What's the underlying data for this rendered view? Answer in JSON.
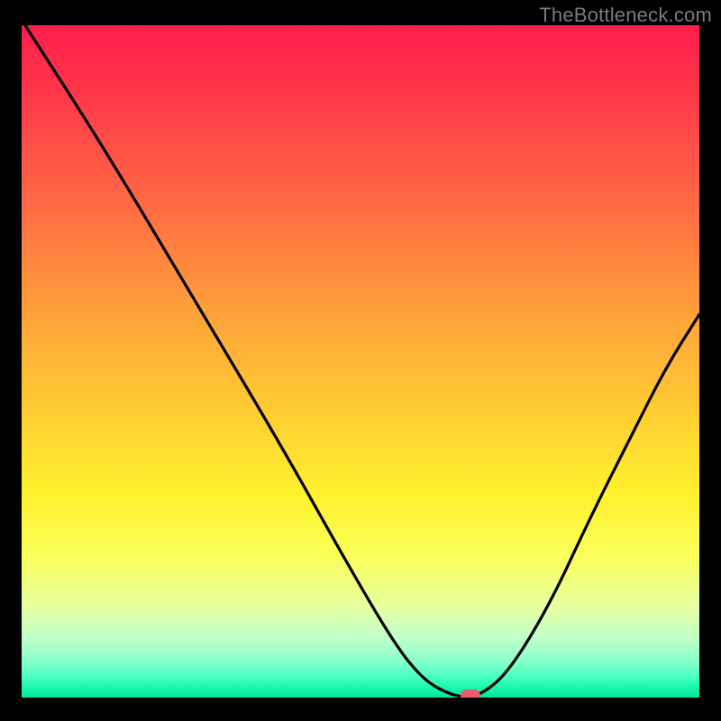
{
  "watermark": "TheBottleneck.com",
  "chart_data": {
    "type": "line",
    "title": "",
    "xlabel": "",
    "ylabel": "",
    "xlim": [
      0,
      100
    ],
    "ylim": [
      0,
      100
    ],
    "grid": false,
    "legend": false,
    "series": [
      {
        "name": "curve",
        "x": [
          0.5,
          12,
          25,
          38,
          48,
          55,
          59,
          62,
          65,
          68,
          72,
          78,
          84,
          90,
          95,
          100
        ],
        "values": [
          100,
          82,
          60,
          38,
          20,
          8,
          3,
          1,
          0,
          0.5,
          4,
          14,
          27,
          39,
          49,
          57
        ]
      }
    ],
    "marker": {
      "x": 66.2,
      "y": 0.3,
      "color": "#ef5b6e"
    },
    "background_gradient": {
      "top": "#ff1d4b",
      "mid_upper": "#ffce32",
      "mid_lower": "#fbff5b",
      "bottom": "#00e597"
    },
    "curve_color": "#000000"
  }
}
